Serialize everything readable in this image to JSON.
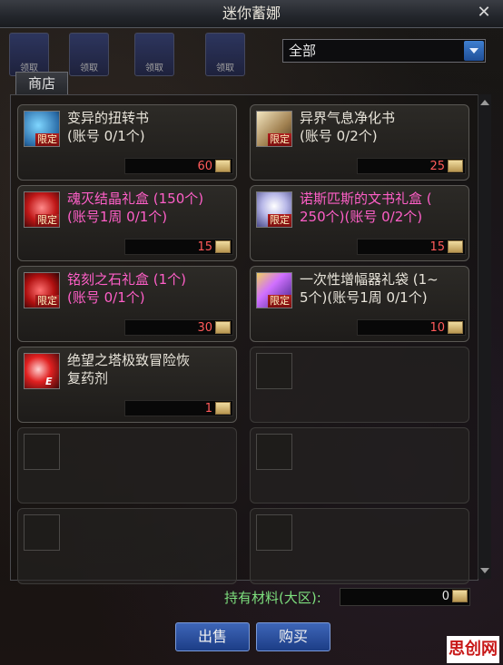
{
  "window": {
    "title": "迷你蓄娜",
    "close_glyph": "✕"
  },
  "top_icons": [
    "领取",
    "领取",
    "领取",
    "领取"
  ],
  "filter": {
    "selected": "全部"
  },
  "tab": {
    "label": "商店"
  },
  "slots": [
    {
      "name": "变异的扭转书\n(账号 0/1个)",
      "badge": "限定",
      "price": "60",
      "name_color": "white",
      "icon_colors": [
        "#7fd6ff",
        "#2a6ca8"
      ]
    },
    {
      "name": "异界气息净化书\n(账号 0/2个)",
      "badge": "限定",
      "price": "25",
      "name_color": "white",
      "icon_colors": [
        "#f3e6c0",
        "#a08050"
      ]
    },
    {
      "name": "魂灭结晶礼盒 (150个)\n(账号1周 0/1个)",
      "badge": "限定",
      "price": "15",
      "name_color": "pink",
      "icon_colors": [
        "#ff5a5a",
        "#8a1010"
      ]
    },
    {
      "name": "诺斯匹斯的文书礼盒 (\n250个)(账号 0/2个)",
      "badge": "限定",
      "price": "15",
      "name_color": "pink",
      "icon_colors": [
        "#d8d8ff",
        "#5a5aa8"
      ]
    },
    {
      "name": "铭刻之石礼盒 (1个)\n(账号 0/1个)",
      "badge": "限定",
      "price": "30",
      "name_color": "pink",
      "icon_colors": [
        "#ff4848",
        "#6a0a0a"
      ]
    },
    {
      "name": "一次性增幅器礼袋 (1~\n5个)(账号1周 0/1个)",
      "badge": "限定",
      "price": "10",
      "name_color": "white",
      "icon_colors": [
        "#d070ff",
        "#3a2080"
      ]
    },
    {
      "name": "绝望之塔极致冒险恢\n复药剂",
      "badge": "E",
      "price": "1",
      "name_color": "white",
      "icon_colors": [
        "#ff4040",
        "#801010"
      ]
    }
  ],
  "material": {
    "label": "持有材料(大区):",
    "value": "0"
  },
  "buttons": {
    "sell": "出售",
    "buy": "购买"
  },
  "watermark": "思创网"
}
